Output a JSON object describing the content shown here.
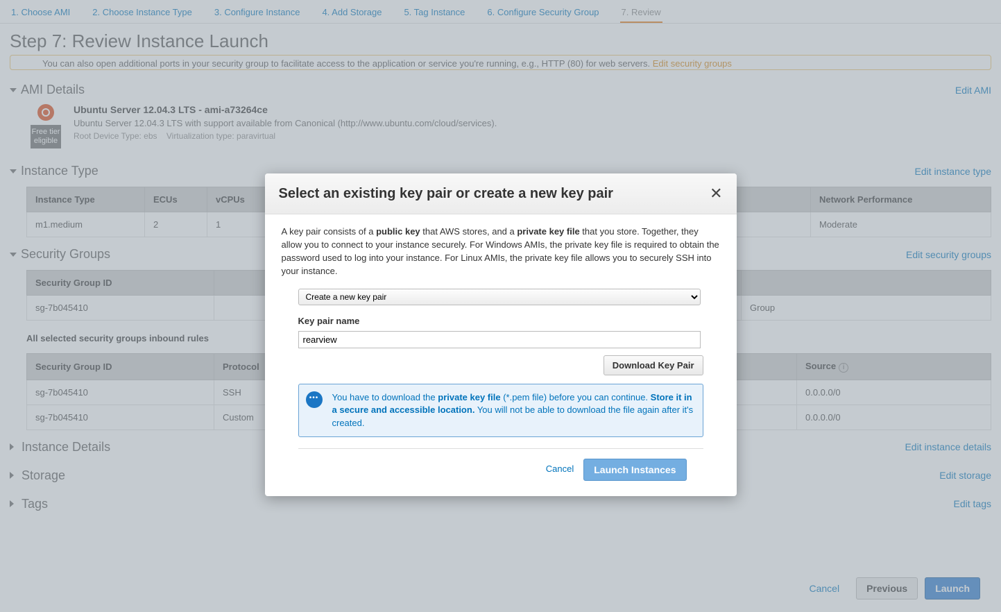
{
  "tabs": [
    {
      "label": "1. Choose AMI"
    },
    {
      "label": "2. Choose Instance Type"
    },
    {
      "label": "3. Configure Instance"
    },
    {
      "label": "4. Add Storage"
    },
    {
      "label": "5. Tag Instance"
    },
    {
      "label": "6. Configure Security Group"
    },
    {
      "label": "7. Review"
    }
  ],
  "page_title": "Step 7: Review Instance Launch",
  "warning": {
    "text": "You can also open additional ports in your security group to facilitate access to the application or service you're running, e.g., HTTP (80) for web servers.",
    "link": "Edit security groups"
  },
  "ami": {
    "section": "AMI Details",
    "edit": "Edit AMI",
    "title": "Ubuntu Server 12.04.3 LTS - ami-a73264ce",
    "desc": "Ubuntu Server 12.04.3 LTS with support available from Canonical (http://www.ubuntu.com/cloud/services).",
    "meta1": "Root Device Type: ebs",
    "meta2": "Virtualization type: paravirtual",
    "free_tier_line1": "Free tier",
    "free_tier_line2": "eligible"
  },
  "instance_type": {
    "section": "Instance Type",
    "edit": "Edit instance type",
    "headers": [
      "Instance Type",
      "ECUs",
      "vCPUs",
      "",
      "Network Performance"
    ],
    "row": [
      "m1.medium",
      "2",
      "1",
      "",
      "Moderate"
    ]
  },
  "security_groups": {
    "section": "Security Groups",
    "edit": "Edit security groups",
    "headers1": [
      "Security Group ID",
      "",
      "",
      ""
    ],
    "row1": [
      "sg-7b045410",
      "",
      "",
      "Group"
    ],
    "sub_label": "All selected security groups inbound rules",
    "headers2": [
      "Security Group ID",
      "Protocol",
      "",
      "Source"
    ],
    "rows2": [
      [
        "sg-7b045410",
        "SSH",
        "",
        "0.0.0.0/0"
      ],
      [
        "sg-7b045410",
        "Custom",
        "",
        "0.0.0.0/0"
      ]
    ]
  },
  "collapsed": [
    {
      "title": "Instance Details",
      "edit": "Edit instance details"
    },
    {
      "title": "Storage",
      "edit": "Edit storage"
    },
    {
      "title": "Tags",
      "edit": "Edit tags"
    }
  ],
  "footer": {
    "cancel": "Cancel",
    "previous": "Previous",
    "launch": "Launch"
  },
  "modal": {
    "title": "Select an existing key pair or create a new key pair",
    "desc_parts": {
      "p1a": "A key pair consists of a ",
      "p1b": "public key",
      "p1c": " that AWS stores, and a ",
      "p1d": "private key file",
      "p1e": " that you store. Together, they allow you to connect to your instance securely. For Windows AMIs, the private key file is required to obtain the password used to log into your instance. For Linux AMIs, the private key file allows you to securely SSH into your instance."
    },
    "select_value": "Create a new key pair",
    "field_label": "Key pair name",
    "input_value": "rearview",
    "download": "Download Key Pair",
    "alert": {
      "a1": "You have to download the ",
      "a2": "private key file",
      "a3": " (*.pem file) before you can continue. ",
      "a4": "Store it in a secure and accessible location.",
      "a5": " You will not be able to download the file again after it's created."
    },
    "cancel": "Cancel",
    "launch": "Launch Instances"
  }
}
